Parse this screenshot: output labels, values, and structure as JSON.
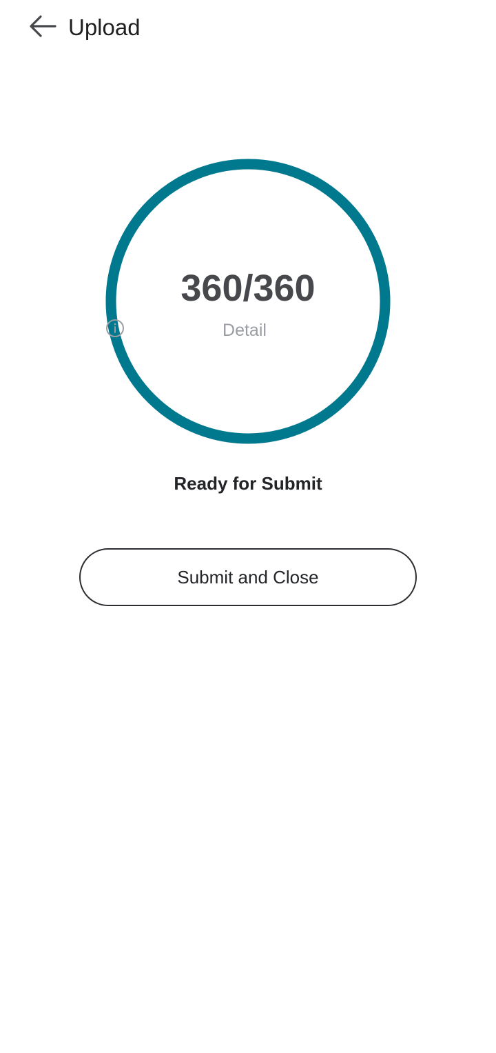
{
  "header": {
    "back_icon": "arrow-left-icon",
    "title": "Upload"
  },
  "progress": {
    "count_text": "360/360",
    "completed": 360,
    "total": 360,
    "fraction": 1.0,
    "ring_color": "#00798f",
    "detail_label": "Detail",
    "detail_icon": "info-icon"
  },
  "status_text": "Ready for Submit",
  "actions": {
    "submit_label": "Submit and Close"
  }
}
